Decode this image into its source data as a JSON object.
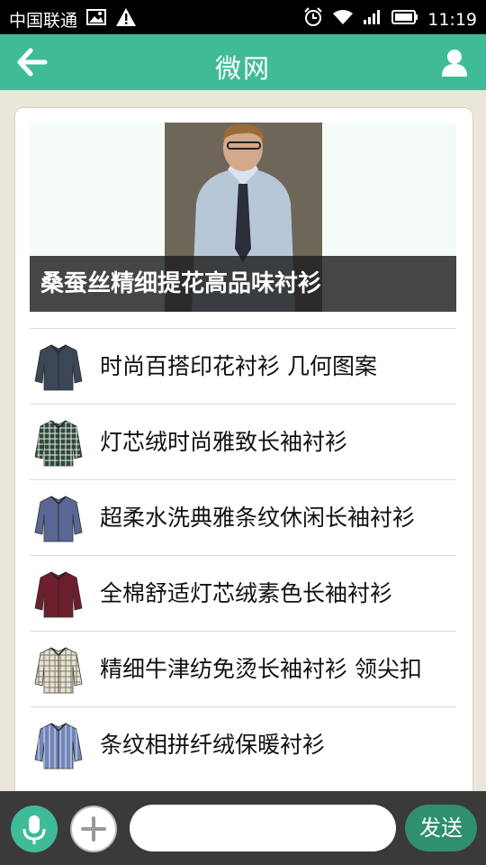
{
  "status_bar": {
    "carrier": "中国联通",
    "time": "11:19",
    "icons": [
      "image-notification-icon",
      "warning-icon",
      "alarm-icon",
      "wifi-icon",
      "signal-icon",
      "battery-icon"
    ]
  },
  "header": {
    "title": "微网",
    "back_icon": "back-arrow-icon",
    "user_icon": "user-icon",
    "background_color": "#3fbb97"
  },
  "featured": {
    "caption": "桑蚕丝精细提花高品味衬衫"
  },
  "items": [
    {
      "label": "时尚百搭印花衬衫 几何图案",
      "shirt_color": "#3b4656",
      "pattern": "plain"
    },
    {
      "label": "灯芯绒时尚雅致长袖衬衫",
      "shirt_color": "#2f4a3c",
      "pattern": "plaid"
    },
    {
      "label": "超柔水洗典雅条纹休闲长袖衬衫",
      "shirt_color": "#5a6795",
      "pattern": "plain"
    },
    {
      "label": "全棉舒适灯芯绒素色长袖衬衫",
      "shirt_color": "#6c1e2c",
      "pattern": "plain"
    },
    {
      "label": "精细牛津纺免烫长袖衬衫 领尖扣",
      "shirt_color": "#e6e0cf",
      "pattern": "check"
    },
    {
      "label": "条纹相拼纤绒保暖衬衫",
      "shirt_color": "#6f86b8",
      "pattern": "stripe"
    }
  ],
  "input_bar": {
    "mic_icon": "microphone-icon",
    "plus_icon": "plus-icon",
    "placeholder": "",
    "send_label": "发送"
  }
}
